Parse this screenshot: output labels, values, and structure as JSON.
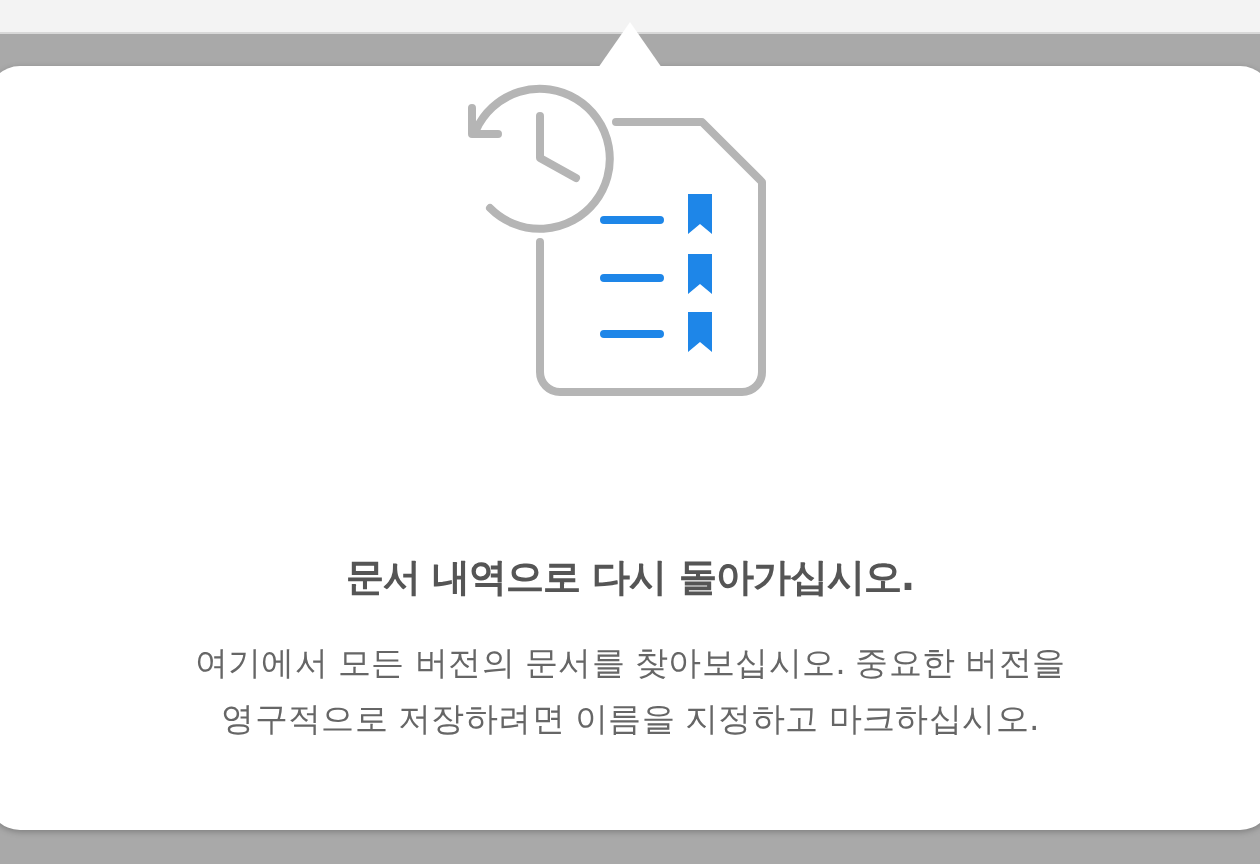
{
  "popover": {
    "title": "문서 내역으로 다시 돌아가십시오.",
    "description": "여기에서 모든 버전의 문서를 찾아보십시오. 중요한 버전을 영구적으로 저장하려면 이름을 지정하고 마크하십시오."
  }
}
